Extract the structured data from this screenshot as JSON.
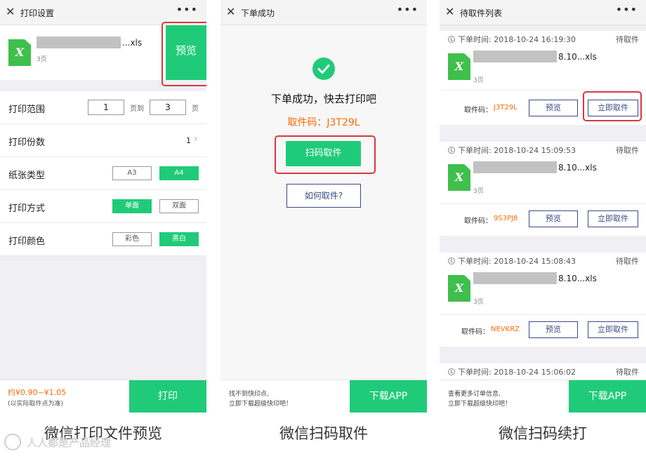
{
  "colors": {
    "green": "#1fcb78",
    "orange": "#ff6a00",
    "navy": "#3b4a85",
    "highlight_red": "#d9383e"
  },
  "screen1": {
    "title": "打印设置",
    "file": {
      "name_suffix": "...xls",
      "pages": "3页",
      "icon": "excel-file-icon"
    },
    "preview_button": "预览",
    "range": {
      "label": "打印范围",
      "from": "1",
      "to_label": "页到",
      "to": "3",
      "page_unit": "页"
    },
    "copies": {
      "label": "打印份数",
      "value": "1"
    },
    "paper": {
      "label": "纸张类型",
      "options": [
        "A3",
        "A4"
      ],
      "selected": "A4"
    },
    "mode": {
      "label": "打印方式",
      "options": [
        "单面",
        "双面"
      ],
      "selected": "单面"
    },
    "color": {
      "label": "打印颜色",
      "options": [
        "彩色",
        "黑白"
      ],
      "selected": "黑白"
    },
    "price": "约¥0.90~¥1.05",
    "price_note": "(以实际取件点为准)",
    "print_button": "打印",
    "caption": "微信打印文件预览"
  },
  "screen2": {
    "title": "下单成功",
    "heading": "下单成功，快去打印吧",
    "code_label": "取件码：",
    "code": "J3T29L",
    "scan_button": "扫码取件",
    "how_button": "如何取件?",
    "footer_line1": "找不到快印点,",
    "footer_line2": "立即下载超级快印吧！",
    "download_button": "下载APP",
    "caption": "微信扫码取件"
  },
  "screen3": {
    "title": "待取件列表",
    "orders": [
      {
        "time": "下单时间: 2018-10-24 16:19:30",
        "status": "待取件",
        "name_suffix": "8.10...xls",
        "pages": "3页",
        "code_label": "取件码：",
        "code": "J3T29L",
        "preview": "预览",
        "pickup": "立即取件"
      },
      {
        "time": "下单时间: 2018-10-24 15:09:53",
        "status": "待取件",
        "name_suffix": "8.10...xls",
        "pages": "3页",
        "code_label": "取件码：",
        "code": "9S3PJ8",
        "preview": "预览",
        "pickup": "立即取件"
      },
      {
        "time": "下单时间: 2018-10-24 15:08:43",
        "status": "待取件",
        "name_suffix": "8.10...xls",
        "pages": "3页",
        "code_label": "取件码：",
        "code": "NEVKRZ",
        "preview": "预览",
        "pickup": "立即取件"
      },
      {
        "time": "下单时间: 2018-10-24 15:06:02",
        "status": "待取件"
      }
    ],
    "footer_line1": "查看更多订单信息,",
    "footer_line2": "立即下载超级快印吧！",
    "download_button": "下载APP",
    "caption": "微信扫码续打"
  },
  "watermark": "人人都是产品经理"
}
